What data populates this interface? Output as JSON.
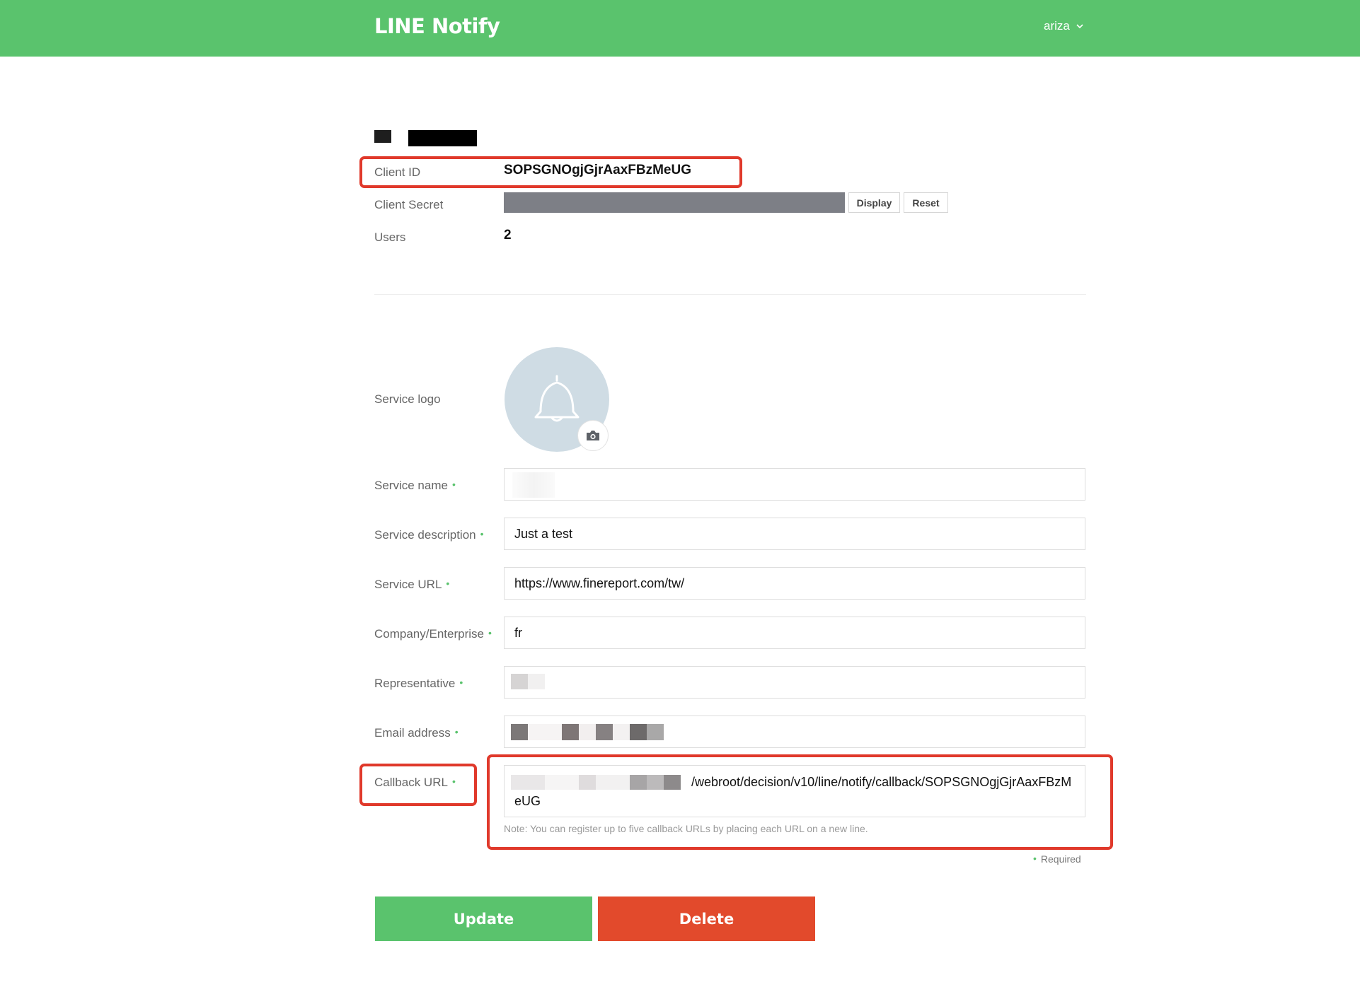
{
  "header": {
    "brand": "LINE Notify",
    "user": "ariza"
  },
  "service_info": {
    "client_id_label": "Client ID",
    "client_id": "SOPSGNOgjGjrAaxFBzMeUG",
    "client_secret_label": "Client Secret",
    "display_label": "Display",
    "reset_label": "Reset",
    "users_label": "Users",
    "users_count": "2"
  },
  "form": {
    "service_logo_label": "Service logo",
    "service_name_label": "Service name",
    "service_name_value": "",
    "service_description_label": "Service description",
    "service_description_value": "Just a test",
    "service_url_label": "Service URL",
    "service_url_value": "https://www.finereport.com/tw/",
    "company_label": "Company/Enterprise",
    "company_value": "fr",
    "representative_label": "Representative",
    "representative_value": "",
    "email_label": "Email address",
    "email_value": "",
    "callback_label": "Callback URL",
    "callback_value": "/webroot/decision/v10/line/notify/callback/SOPSGNOgjGjrAaxFBzMeUG",
    "callback_note": "Note: You can register up to five callback URLs by placing each URL on a new line.",
    "required_dot": "•",
    "required_label": "Required"
  },
  "actions": {
    "update_label": "Update",
    "delete_label": "Delete"
  },
  "colors": {
    "brand_green": "#5ac36d",
    "delete_red": "#e24a2c",
    "highlight_red": "#e0392b",
    "logo_bg": "#cfdce4"
  },
  "icons": {
    "user_menu": "chevron-down-icon",
    "service_logo": "bell-icon",
    "upload": "camera-icon"
  }
}
